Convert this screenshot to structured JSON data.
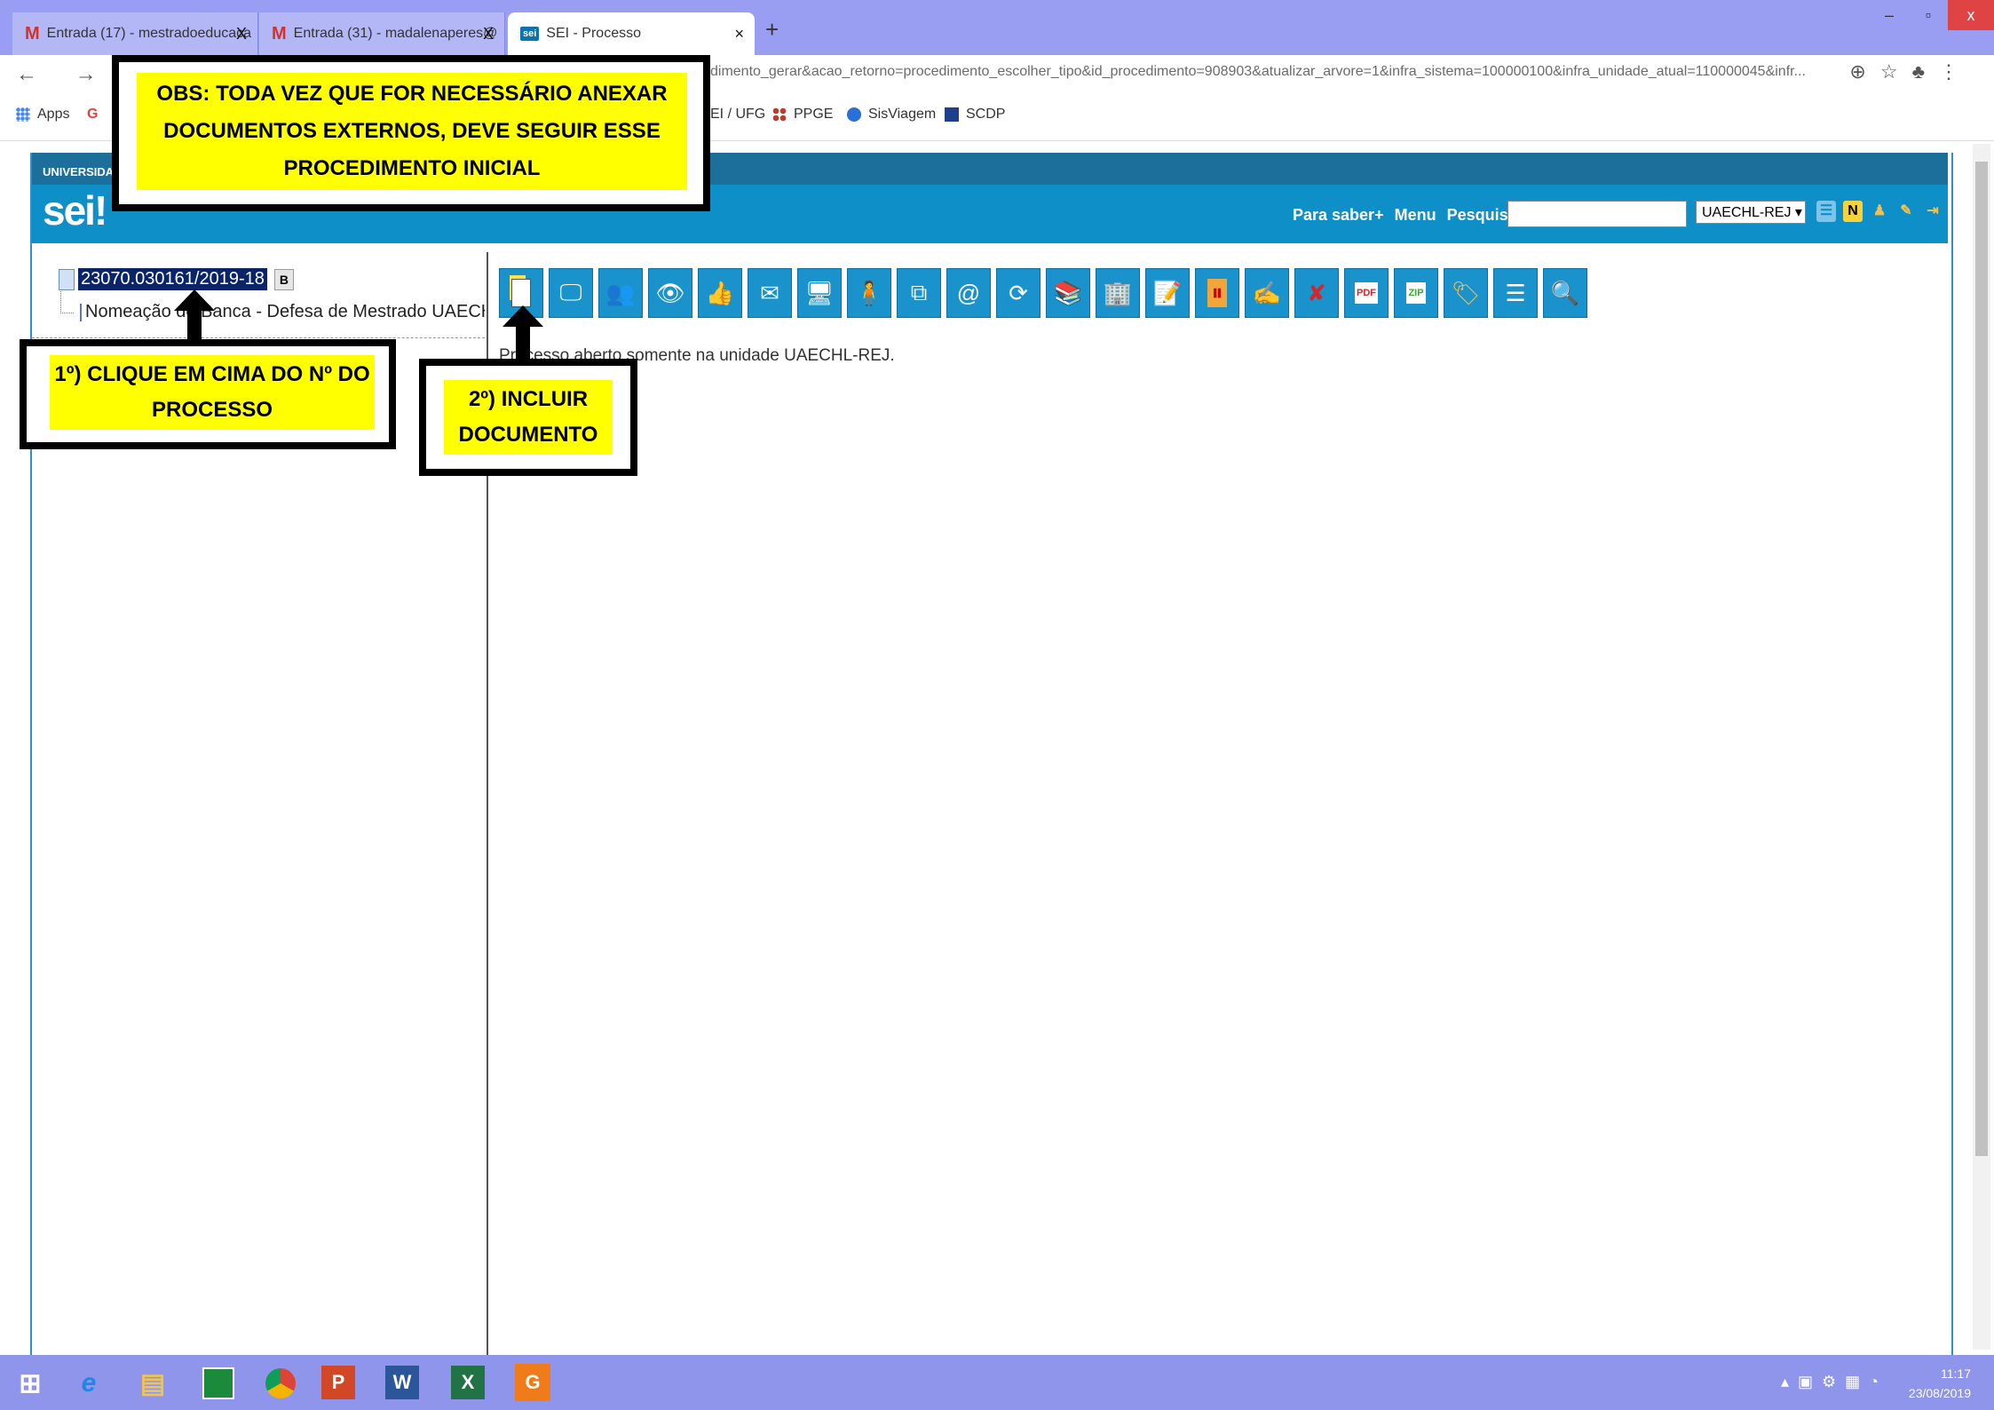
{
  "browser": {
    "tabs": [
      {
        "label": "Entrada (17) - mestradoeducaca",
        "close": "X",
        "icon": "gmail-icon"
      },
      {
        "label": "Entrada (31) - madalenaperes@",
        "close": "X",
        "icon": "gmail-icon"
      },
      {
        "label": "SEI - Processo",
        "close": "×",
        "icon": "sei-icon",
        "badge": "sei"
      }
    ],
    "new_tab": "+",
    "window_controls": {
      "minimize": "–",
      "restore": "▫",
      "close": "x"
    },
    "nav": "← → C",
    "url": "dimento_gerar&acao_retorno=procedimento_escolher_tipo&id_procedimento=908903&atualizar_arvore=1&infra_sistema=100000100&infra_unidade_atual=110000045&infr...",
    "bookmarks": [
      {
        "label": "Apps",
        "icon": "apps-grid-icon"
      },
      {
        "label": "G",
        "icon": "google-icon"
      },
      {
        "label": "EI / UFG",
        "icon": "page-icon"
      },
      {
        "label": "PPGE",
        "icon": "ppge-icon"
      },
      {
        "label": "SisViagem",
        "icon": "sisviagem-icon"
      },
      {
        "label": "SCDP",
        "icon": "scdp-icon"
      }
    ]
  },
  "sei": {
    "university_label": "UNIVERSIDA",
    "logo": "sei!",
    "links": [
      "Para saber+",
      "Menu",
      "Pesquisa"
    ],
    "search_value": "",
    "unit": "UAECHL-REJ ▾",
    "tree": {
      "process_number": "23070.030161/2019-18",
      "process_badge": "B",
      "document": "Nomeação de Banca - Defesa de Mestrado UAECHL"
    },
    "status_text": "Processo aberto somente na unidade UAECHL-REJ.",
    "colors": {
      "header": "#0f8fc8",
      "accent": "#1d6f9b"
    }
  },
  "annotations": {
    "obs": "OBS: TODA VEZ QUE FOR NECESSÁRIO ANEXAR DOCUMENTOS EXTERNOS, DEVE SEGUIR ESSE PROCEDIMENTO INICIAL",
    "step1": "1º) CLIQUE EM CIMA DO Nº DO PROCESSO",
    "step2": "2º) INCLUIR DOCUMENTO"
  },
  "taskbar": {
    "clock_time": "11:17",
    "clock_date": "23/08/2019"
  }
}
